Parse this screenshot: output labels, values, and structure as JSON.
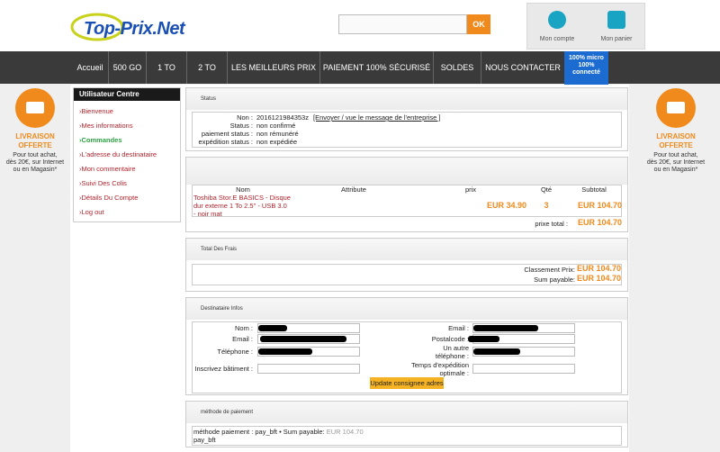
{
  "header": {
    "logo_text": "Top-Prix.Net",
    "search_placeholder": "",
    "search_btn": "OK",
    "account_label": "Mon compte",
    "cart_label": "Mon panier"
  },
  "nav": {
    "items": [
      "Accueil",
      "500 GO",
      "1 TO",
      "2 TO",
      "LES MEILLEURS PRIX",
      "PAIEMENT 100% SÉCURISÉ",
      "SOLDES",
      "NOUS CONTACTER"
    ],
    "promo": [
      "100% micro",
      "100%",
      "connecté"
    ]
  },
  "promo": {
    "title_line1": "LIVRAISON",
    "title_line2": "OFFERTE",
    "text_line1": "Pour tout achat,",
    "text_line2": "dès 20€, sur Internet",
    "text_line3": "ou en Magasin*"
  },
  "user_centre": {
    "title": "Utilisateur Centre",
    "items": [
      "Bienvenue",
      "Mes informations",
      "Commandes",
      "L'adresse du destinataire",
      "Mon commentaire",
      "Suivi Des Colis",
      "Détails Du Compte",
      "Log out"
    ],
    "active_index": 2
  },
  "status": {
    "head": "Status",
    "labels": [
      "Non :",
      "Status :",
      "paiement status :",
      "expédition status :"
    ],
    "values": [
      "2016121984353z",
      "non confirmé",
      "non rémunéré",
      "non expédiée"
    ],
    "link": "[Envoyer / vue le message de l'entreprise ]"
  },
  "items": {
    "headers": [
      "Nom",
      "Attribute",
      "prix",
      "Qté",
      "Subtotal"
    ],
    "rows": [
      {
        "name": "Toshiba Stor.E BASICS - Disque dur externe 1 To 2.5\" - USB 3.0 - noir mat",
        "attribute": "",
        "price": "EUR 34.90",
        "qty": "3",
        "subtotal": "EUR 104.70"
      }
    ],
    "total_label": "prixe total :",
    "total_value": "EUR 104.70"
  },
  "frais": {
    "head": "Total Des Frais",
    "classement_label": "Classement Prix:",
    "classement_value": "EUR 104.70",
    "sum_label": "Sum payable:",
    "sum_value": "EUR 104.70"
  },
  "destinataire": {
    "head": "Destinataire Infos",
    "left_labels": [
      "Nom :",
      "Email :",
      "Téléphone :",
      "Inscrivez bâtiment :"
    ],
    "right_labels": [
      "Email :",
      "Postalcode :",
      "Un autre téléphone :",
      "Temps d'expédition optimale :"
    ],
    "button": "Update consignee adres"
  },
  "paiement": {
    "head": "méthode de paiement",
    "line1_label": "méthode paiement :",
    "line1_value": "pay_bft",
    "sum_label": "Sum payable:",
    "sum_value": "EUR 104.70",
    "line2": "pay_bft"
  },
  "colors": {
    "accent": "#f08a1c",
    "nav_bg": "#3a3a3a",
    "link_red": "#b2222b",
    "active_green": "#2ea043",
    "promo_blue": "#1c6bd0"
  }
}
